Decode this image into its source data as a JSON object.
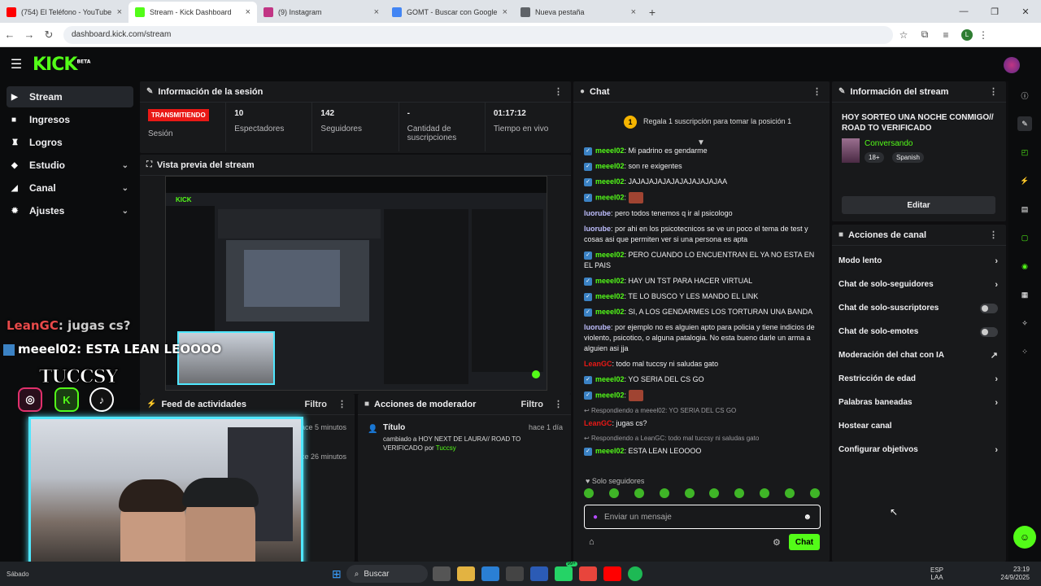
{
  "browser": {
    "tabs": [
      {
        "title": "(754) El Teléfono - YouTube",
        "color": "#ff0000"
      },
      {
        "title": "Stream - Kick Dashboard",
        "color": "#53fc18"
      },
      {
        "title": "(9) Instagram",
        "color": "#c13584"
      },
      {
        "title": "GOMT - Buscar con Google",
        "color": "#4285f4"
      },
      {
        "title": "Nueva pestaña",
        "color": "#5f6368"
      }
    ],
    "url": "dashboard.kick.com/stream",
    "profile": "L"
  },
  "kick": {
    "logo": "KICK",
    "logo_sup": "BETA"
  },
  "sidebar": {
    "items": [
      {
        "label": "Stream",
        "icon": "video-icon"
      },
      {
        "label": "Ingresos",
        "icon": "revenue-icon"
      },
      {
        "label": "Logros",
        "icon": "trophy-icon"
      },
      {
        "label": "Estudio",
        "icon": "studio-icon"
      },
      {
        "label": "Canal",
        "icon": "channel-icon"
      },
      {
        "label": "Ajustes",
        "icon": "gear-icon"
      }
    ]
  },
  "session": {
    "title": "Información de la sesión",
    "live_badge": "TRANSMITIENDO",
    "session_label": "Sesión",
    "viewers": "10",
    "viewers_label": "Espectadores",
    "followers": "142",
    "followers_label": "Seguidores",
    "subs": "-",
    "subs_label": "Cantidad de suscripciones",
    "uptime": "01:17:12",
    "uptime_label": "Tiempo en vivo"
  },
  "preview": {
    "title": "Vista previa del stream",
    "logo": "KICK"
  },
  "overlay": {
    "chat1_user": "LeanGC",
    "chat1_text": ": jugas cs?",
    "chat2_user": "meeel02",
    "chat2_text": ": ESTA LEAN LEOOOO",
    "name": "TUCCSY"
  },
  "feed": {
    "title": "Feed de actividades",
    "filter": "Filtro",
    "t1": "hace 5 minutos",
    "t2": "hace 26 minutos"
  },
  "modactions": {
    "title": "Acciones de moderador",
    "filter": "Filtro",
    "item_title": "Título",
    "item_time": "hace 1 día",
    "item_text": "cambiado a HOY NEXT DE LAURA// ROAD TO VERIFICADO por ",
    "item_user": "Tuccsy"
  },
  "chat": {
    "title": "Chat",
    "gift_text": "Regala 1 suscripción para tomar la posición 1",
    "gift_num": "1",
    "messages": [
      {
        "user": "meeel02",
        "cls": "u1",
        "icon": true,
        "text": "Mi padrino es gendarme"
      },
      {
        "user": "meeel02",
        "cls": "u1",
        "icon": true,
        "text": "son re exigentes"
      },
      {
        "user": "meeel02",
        "cls": "u1",
        "icon": true,
        "text": "JAJAJAJAJAJAJAJAJAJAJAA"
      },
      {
        "user": "meeel02",
        "cls": "u1",
        "icon": true,
        "text": "",
        "emote": true
      },
      {
        "user": "luorube",
        "cls": "u2",
        "icon": false,
        "text": "pero todos tenemos q ir al psicologo"
      },
      {
        "user": "luorube",
        "cls": "u2",
        "icon": false,
        "text": "por ahi en los psicotecnicos se ve un poco el tema de test y cosas asi que permiten ver si una persona es apta"
      },
      {
        "user": "meeel02",
        "cls": "u1",
        "icon": true,
        "text": "PERO CUANDO LO ENCUENTRAN EL YA NO ESTA EN EL PAIS"
      },
      {
        "user": "meeel02",
        "cls": "u1",
        "icon": true,
        "text": "HAY UN TST PARA HACER VIRTUAL"
      },
      {
        "user": "meeel02",
        "cls": "u1",
        "icon": true,
        "text": "TE LO BUSCO Y LES MANDO EL LINK"
      },
      {
        "user": "meeel02",
        "cls": "u1",
        "icon": true,
        "text": "SI, A LOS GENDARMES LOS TORTURAN UNA BANDA"
      },
      {
        "user": "luorube",
        "cls": "u2",
        "icon": false,
        "text": "por ejemplo no es alguien apto para policia y tiene indicios de violento, psicotico, o alguna patalogia. No esta bueno darle un arma a alguien asi jja"
      },
      {
        "user": "LeanGC",
        "cls": "u3",
        "icon": false,
        "text": "todo mal tuccsy ni saludas gato"
      },
      {
        "user": "meeel02",
        "cls": "u1",
        "icon": true,
        "text": "YO SERIA DEL CS GO"
      },
      {
        "user": "meeel02",
        "cls": "u1",
        "icon": true,
        "text": "",
        "emote": true
      },
      {
        "reply": "Respondiendo a meeel02: YO SERIA DEL CS GO",
        "user": "LeanGC",
        "cls": "u3",
        "icon": false,
        "text": "jugas cs?"
      },
      {
        "reply": "Respondiendo a LeanGC: todo mal tuccsy ni saludas gato",
        "user": "meeel02",
        "cls": "u1",
        "icon": true,
        "text": "ESTA LEAN LEOOOO"
      }
    ],
    "followers_only": "Solo seguidores",
    "input_placeholder": "Enviar un mensaje",
    "send_label": "Chat"
  },
  "stream_info": {
    "title": "Información del stream",
    "stream_title": "HOY SORTEO UNA NOCHE CONMIGO// ROAD TO VERIFICADO",
    "category": "Conversando",
    "tag1": "18+",
    "tag2": "Spanish",
    "edit": "Editar"
  },
  "channel_actions": {
    "title": "Acciones de canal",
    "items": [
      {
        "label": "Modo lento",
        "ctrl": "arrow"
      },
      {
        "label": "Chat de solo-seguidores",
        "ctrl": "arrow"
      },
      {
        "label": "Chat de solo-suscriptores",
        "ctrl": "toggle"
      },
      {
        "label": "Chat de solo-emotes",
        "ctrl": "toggle"
      },
      {
        "label": "Moderación del chat con IA",
        "ctrl": "external"
      },
      {
        "label": "Restricción de edad",
        "ctrl": "arrow"
      },
      {
        "label": "Palabras baneadas",
        "ctrl": "arrow"
      },
      {
        "label": "Hostear canal",
        "ctrl": "none"
      },
      {
        "label": "Configurar objetivos",
        "ctrl": "arrow"
      }
    ]
  },
  "taskbar": {
    "search": "Buscar",
    "time": "23:19",
    "date": "24/9/2025",
    "lang": "ESP",
    "lang2": "LAA",
    "weather": "Sábado",
    "badge": "99+"
  }
}
